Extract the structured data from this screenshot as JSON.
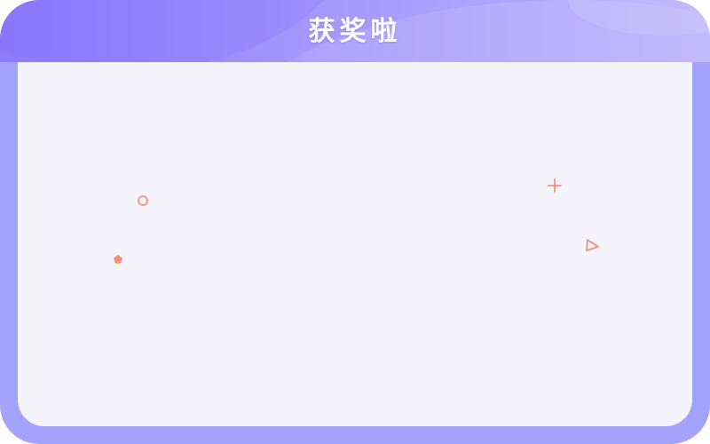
{
  "dialog": {
    "title": "获奖啦"
  },
  "colors": {
    "frame": "#a3a3fb",
    "header_start": "#8d7bfd",
    "header_end": "#bcb2fb",
    "panel": "#f5f3fc",
    "decoration": "#f59174",
    "title_text": "#ffffff"
  },
  "decorations": [
    {
      "name": "circle-outline-icon"
    },
    {
      "name": "pentagon-icon"
    },
    {
      "name": "plus-icon"
    },
    {
      "name": "triangle-outline-icon"
    }
  ]
}
